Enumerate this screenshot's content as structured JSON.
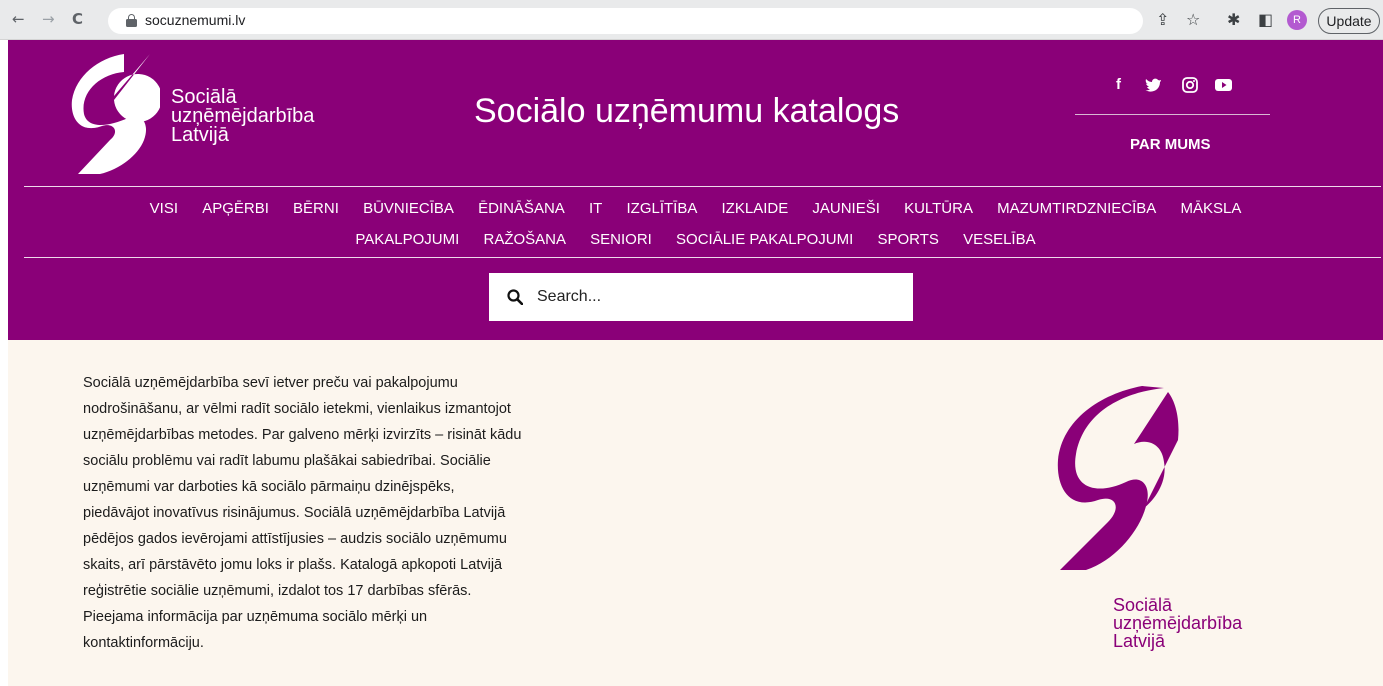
{
  "browser": {
    "url": "socuznemumi.lv",
    "profile_initial": "R",
    "update_label": "Update"
  },
  "header": {
    "logo_lines": [
      "Sociālā",
      "uzņēmējdarbība",
      "Latvijā"
    ],
    "title": "Sociālo uzņēmumu katalogs",
    "social_icons": [
      "facebook-icon",
      "twitter-icon",
      "instagram-icon",
      "youtube-icon"
    ],
    "about_link": "PAR MUMS",
    "categories_row1": [
      "VISI",
      "APĢĒRBI",
      "BĒRNI",
      "BŪVNIECĪBA",
      "ĒDINĀŠANA",
      "IT",
      "IZGLĪTĪBA",
      "IZKLAIDE",
      "JAUNIEŠI",
      "KULTŪRA",
      "MAZUMTIRDZNIECĪBA",
      "MĀKSLA"
    ],
    "categories_row2": [
      "PAKALPOJUMI",
      "RAŽOŠANA",
      "SENIORI",
      "SOCIĀLIE PAKALPOJUMI",
      "SPORTS",
      "VESELĪBA"
    ],
    "search_placeholder": "Search..."
  },
  "content": {
    "intro_text": "Sociālā uzņēmējdarbība sevī ietver preču vai pakalpojumu nodrošināšanu, ar vēlmi radīt sociālo ietekmi, vienlaikus izmantojot uzņēmējdarbības metodes. Par galveno mērķi izvirzīts – risināt kādu sociālu problēmu vai radīt labumu plašākai sabiedrībai. Sociālie uzņēmumi var darboties kā sociālo pārmaiņu dzinējspēks, piedāvājot inovatīvus risinājumus. Sociālā uzņēmējdarbība Latvijā pēdējos gados ievērojami attīstījusies – audzis sociālo uzņēmumu skaits, arī pārstāvēto jomu loks ir plašs. Katalogā apkopoti Latvijā reģistrētie sociālie uzņēmumi, izdalot tos 17 darbības sfērās. Pieejama informācija par uzņēmuma sociālo mērķi un kontaktinformāciju.",
    "intro_lines": [
      "Sociālā uzņēmējdarbība sevī ietver preču vai pakalpojumu",
      "nodrošināšanu, ar vēlmi radīt sociālo ietekmi, vienlaikus izmantojot",
      "uzņēmējdarbības metodes. Par galveno mērķi izvirzīts – risināt kādu",
      "sociālu problēmu vai radīt labumu plašākai sabiedrībai. Sociālie",
      "uzņēmumi var darboties kā sociālo pārmaiņu dzinējspēks,",
      "piedāvājot inovatīvus risinājumus. Sociālā uzņēmējdarbība Latvijā",
      "pēdējos gados ievērojami attīstījusies – audzis sociālo uzņēmumu",
      "skaits, arī pārstāvēto jomu loks ir plašs. Katalogā apkopoti Latvijā",
      "reģistrētie sociālie uzņēmumi, izdalot tos 17 darbības sfērās.",
      "Pieejama informācija par uzņēmuma sociālo mērķi un",
      "kontaktinformāciju."
    ],
    "logo_lines": [
      "Sociālā",
      "uzņēmējdarbība",
      "Latvijā"
    ]
  },
  "colors": {
    "brand_purple": "#8a0078",
    "content_bg": "#fcf6ee"
  }
}
